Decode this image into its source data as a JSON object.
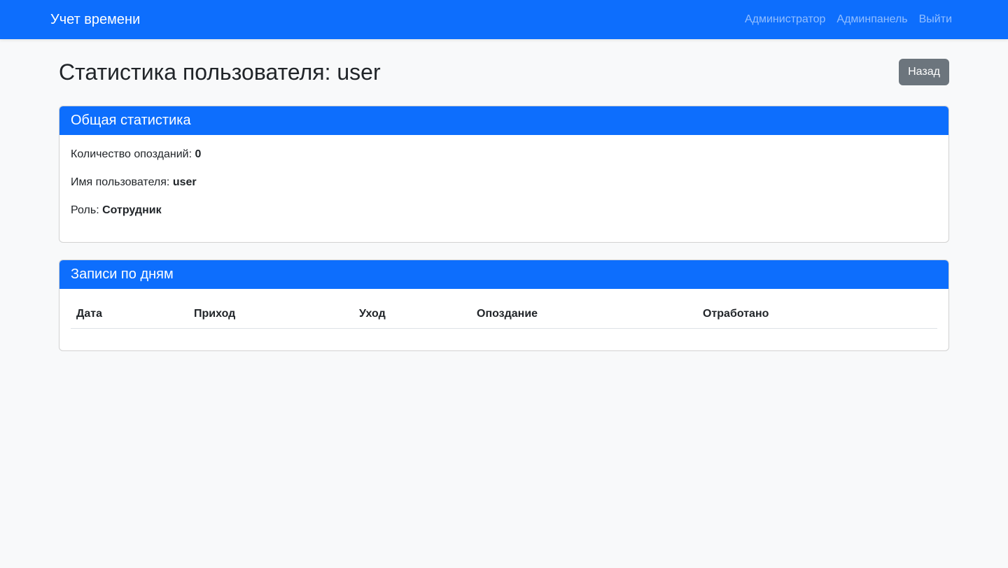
{
  "navbar": {
    "brand": "Учет времени",
    "links": [
      "Администратор",
      "Админпанель",
      "Выйти"
    ]
  },
  "page": {
    "title": "Статистика пользователя: user",
    "back_button": "Назад"
  },
  "stats_card": {
    "header": "Общая статистика",
    "lines": [
      {
        "label": "Количество опозданий:",
        "value": "0"
      },
      {
        "label": "Имя пользователя:",
        "value": "user"
      },
      {
        "label": "Роль:",
        "value": "Сотрудник"
      }
    ]
  },
  "days_card": {
    "header": "Записи по дням",
    "columns": [
      "Дата",
      "Приход",
      "Уход",
      "Опоздание",
      "Отработано"
    ],
    "rows": []
  },
  "colors": {
    "primary": "#0d6efd",
    "secondary": "#6c757d",
    "background": "#f8f9fa"
  }
}
